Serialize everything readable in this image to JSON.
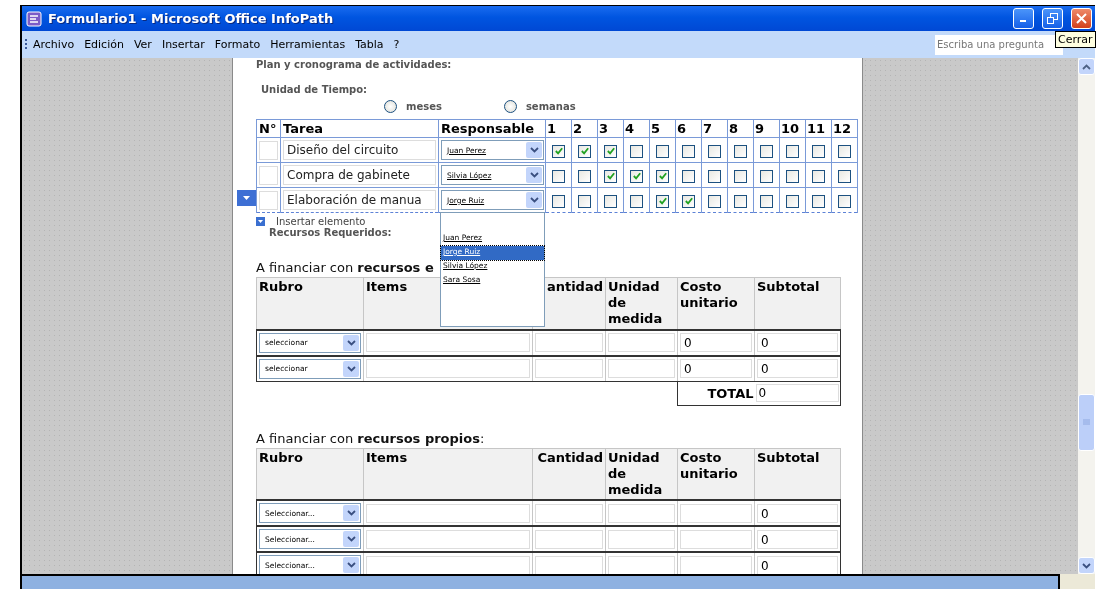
{
  "window": {
    "title": "Formulario1 - Microsoft Office InfoPath",
    "close_tooltip": "Cerrar"
  },
  "menu": [
    "Archivo",
    "Edición",
    "Ver",
    "Insertar",
    "Formato",
    "Herramientas",
    "Tabla",
    "?"
  ],
  "help_search": {
    "placeholder": "Escriba una pregunta"
  },
  "schedule": {
    "title": "Plan y cronograma de actividades:",
    "time_unit": {
      "label": "Unidad de Tiempo:",
      "options": [
        {
          "label": "meses",
          "selected": false
        },
        {
          "label": "semanas",
          "selected": false
        }
      ]
    },
    "columns": [
      "N°",
      "Tarea",
      "Responsable",
      "1",
      "2",
      "3",
      "4",
      "5",
      "6",
      "7",
      "8",
      "9",
      "10",
      "11",
      "12"
    ],
    "rows": [
      {
        "task": "Diseño del circuito",
        "responsible": "Juan Perez",
        "selected": false,
        "weeks": [
          true,
          true,
          true,
          false,
          false,
          false,
          false,
          false,
          false,
          false,
          false,
          false
        ]
      },
      {
        "task": "Compra de gabinete",
        "responsible": "Silvia López",
        "selected": false,
        "weeks": [
          false,
          false,
          true,
          true,
          true,
          false,
          false,
          false,
          false,
          false,
          false,
          false
        ]
      },
      {
        "task": "Elaboración de manua",
        "responsible": "Jorge Ruiz",
        "selected": true,
        "weeks": [
          false,
          false,
          false,
          false,
          true,
          true,
          false,
          false,
          false,
          false,
          false,
          false
        ],
        "dropdown_options": [
          {
            "label": "Juan Perez",
            "selected": false
          },
          {
            "label": "Jorge Ruiz",
            "selected": true
          },
          {
            "label": "Silvia López",
            "selected": false
          },
          {
            "label": "Sara Sosa",
            "selected": false
          }
        ]
      }
    ],
    "insert_label": "Insertar elemento"
  },
  "resources_label": "Recursos Requeridos:",
  "external_funding": {
    "heading": "A financiar con **recursos e**",
    "columns": [
      "Rubro",
      "Items",
      "antidad",
      "Unidad de medida",
      "Costo unitario",
      "Subtotal"
    ],
    "rows": [
      {
        "rubro": "seleccionar",
        "cost": "0",
        "subtotal": "0"
      },
      {
        "rubro": "seleccionar",
        "cost": "0",
        "subtotal": "0"
      }
    ],
    "total_label": "TOTAL",
    "total": "0"
  },
  "own_funding": {
    "heading": "A financiar con **recursos propios**:",
    "columns": [
      "Rubro",
      "Items",
      "Cantidad",
      "Unidad de medida",
      "Costo unitario",
      "Subtotal"
    ],
    "rows": [
      {
        "rubro": "Seleccionar...",
        "subtotal": "0"
      },
      {
        "rubro": "Seleccionar...",
        "subtotal": "0"
      },
      {
        "rubro": "Seleccionar...",
        "subtotal": "0"
      }
    ]
  }
}
